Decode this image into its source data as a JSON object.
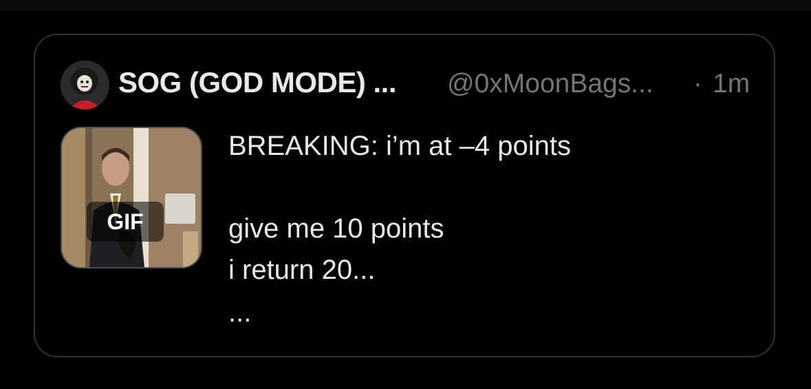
{
  "quote": {
    "author": {
      "display_name": "SOG (GOD MODE) ...",
      "handle": "@0xMoonBags...",
      "separator": "·",
      "time": "1m",
      "avatar_icon": "avatar-icon"
    },
    "media": {
      "badge": "GIF",
      "icon": "gif-thumbnail"
    },
    "text_lines": [
      "BREAKING: i’m at –4 points",
      "give me 10 points",
      "i return 20...",
      "..."
    ]
  },
  "colors": {
    "background": "#000000",
    "card_border": "#2f3336",
    "primary_text": "#e7e9ea",
    "secondary_text": "#71767b"
  }
}
